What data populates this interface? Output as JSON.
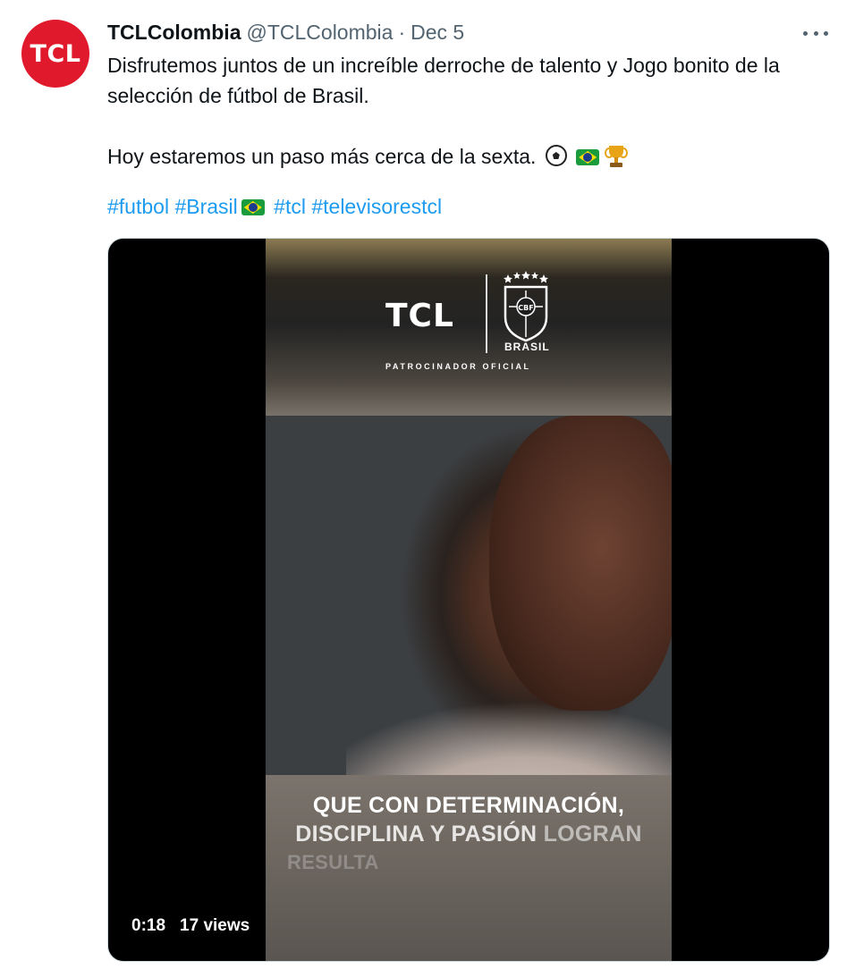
{
  "author": {
    "display_name": "TCLColombia",
    "handle": "@TCLColombia",
    "separator": "·",
    "date": "Dec 5",
    "avatar_text": "TCL"
  },
  "tweet": {
    "line1": "Disfrutemos juntos de un increíble derroche de talento y Jogo bonito de la selección de fútbol de Brasil.",
    "line2": "Hoy estaremos un paso más cerca de la sexta.",
    "line2_emojis": [
      "soccer-ball",
      "brazil-flag",
      "trophy"
    ],
    "hashtags": [
      {
        "text": "#futbol"
      },
      {
        "text": "#Brasil",
        "emoji": "brazil-flag"
      },
      {
        "text": "#tcl"
      },
      {
        "text": "#televisorestcl"
      }
    ]
  },
  "video": {
    "logo": "TCL",
    "crest_label": "BRASIL",
    "crest_text": "CBF",
    "sponsor": "PATROCINADOR   OFICIAL",
    "caption_line1": "QUE CON DETERMINACIÓN,",
    "caption_line2_a": "DISCIPLINA Y PASIÓN",
    "caption_line2_b": "LOGRAN",
    "caption_line3": "RESULTA",
    "time": "0:18",
    "views": "17 views"
  },
  "colors": {
    "avatar_bg": "#e1192c",
    "link": "#1d9bf0",
    "secondary_text": "#536471",
    "primary_text": "#0f1419"
  }
}
